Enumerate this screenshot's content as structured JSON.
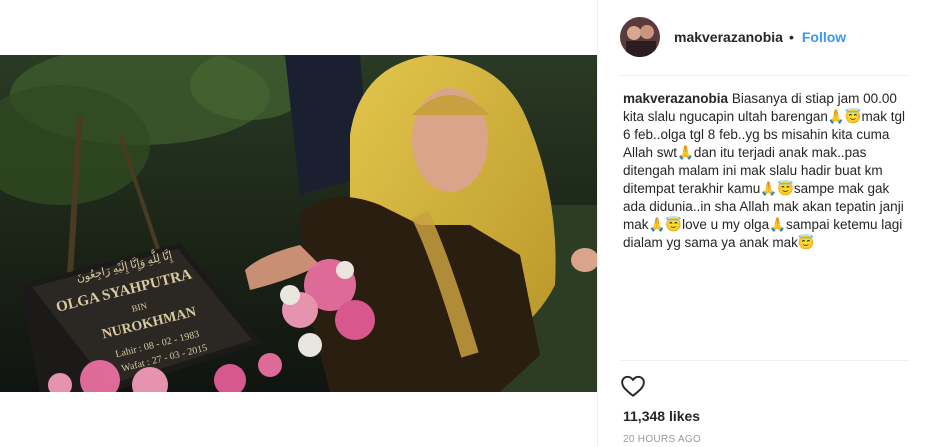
{
  "post": {
    "username": "makverazanobia",
    "separator": "•",
    "follow_label": "Follow",
    "caption_user": "makverazanobia",
    "caption_text": "Biasanya di stiap jam 00.00 kita slalu ngucapin ultah barengan🙏😇mak tgl 6 feb..olga tgl 8 feb..yg bs misahin kita cuma Allah swt🙏dan itu terjadi anak mak..pas ditengah malam ini mak slalu hadir buat km ditempat terakhir kamu🙏😇sampe mak gak ada didunia..in sha Allah mak akan tepatin janji mak🙏😇love u my olga🙏sampai ketemu lagi dialam yg sama ya anak mak😇",
    "likes": "11,348 likes",
    "timestamp": "20 HOURS AGO"
  },
  "photo": {
    "grave_arabic": "إِنَّا لِلَّٰهِ وَإِنَّا إِلَيْهِ رَاجِعُونَ",
    "grave_name": "OLGA SYAHPUTRA",
    "grave_bin": "BIN",
    "grave_father": "NUROKHMAN",
    "grave_lahir": "Lahir : 08 - 02 - 1983",
    "grave_wafat": "Wafat : 27 - 03 - 2015"
  },
  "icons": {
    "heart": "heart-outline-icon",
    "avatar": "profile-avatar"
  },
  "colors": {
    "follow": "#3897f0",
    "text": "#262626",
    "muted": "#999999",
    "scarf": "#d6b53a"
  }
}
